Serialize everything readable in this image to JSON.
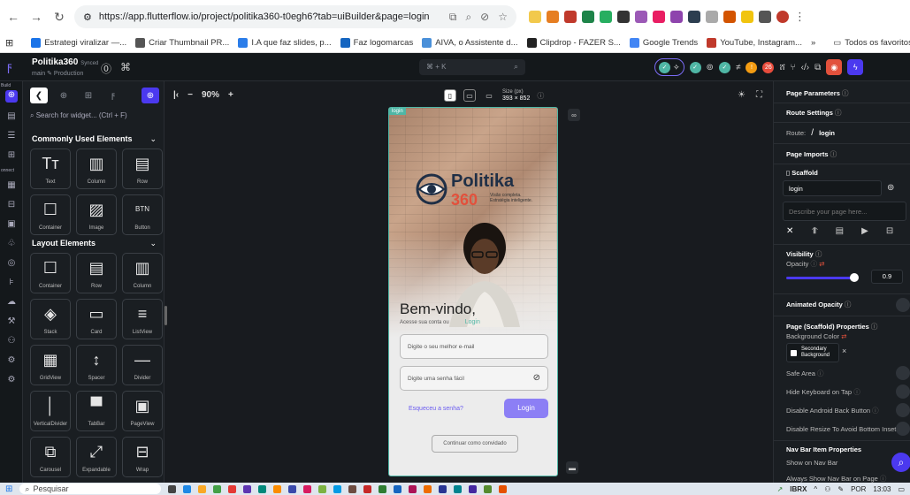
{
  "browser": {
    "url": "https://app.flutterflow.io/project/politika360-t0egh6?tab=uiBuilder&page=login",
    "bookmarks": [
      {
        "label": "Estrategi viralizar —...",
        "color": "#1a73e8"
      },
      {
        "label": "Criar Thumbnail PR...",
        "color": "#555555"
      },
      {
        "label": "I.A que faz slides, p...",
        "color": "#2b7de9"
      },
      {
        "label": "Faz logomarcas",
        "color": "#1565c0"
      },
      {
        "label": "AIVA, o Assistente d...",
        "color": "#4a90d9"
      },
      {
        "label": "Clipdrop - FAZER S...",
        "color": "#222222"
      },
      {
        "label": "Google Trends",
        "color": "#4285f4"
      },
      {
        "label": "YouTube, Instagram...",
        "color": "#c0392b"
      }
    ],
    "more": "»",
    "all_favorites": "Todos os favoritos"
  },
  "topbar": {
    "project_name": "Politika360",
    "synced": "Synced",
    "branch": "main  ✎ Production",
    "search_shortcut": "⌘ + K",
    "badge_count": "26"
  },
  "rail": {
    "build_label": "Build",
    "connect_label": "onnect"
  },
  "panel": {
    "search_placeholder": "Search for widget... (Ctrl + F)",
    "commonly_used": "Commonly Used Elements",
    "layout_elements": "Layout Elements",
    "common_items": [
      {
        "label": "Text",
        "icon": "Tт"
      },
      {
        "label": "Column",
        "icon": "▥"
      },
      {
        "label": "Row",
        "icon": "▤"
      },
      {
        "label": "Container",
        "icon": "☐"
      },
      {
        "label": "Image",
        "icon": "▨"
      },
      {
        "label": "Button",
        "icon": "BTN"
      }
    ],
    "layout_items": [
      {
        "label": "Container",
        "icon": "☐"
      },
      {
        "label": "Row",
        "icon": "▤"
      },
      {
        "label": "Column",
        "icon": "▥"
      },
      {
        "label": "Stack",
        "icon": "◈"
      },
      {
        "label": "Card",
        "icon": "▭"
      },
      {
        "label": "ListView",
        "icon": "≡"
      },
      {
        "label": "GridView",
        "icon": "▦"
      },
      {
        "label": "Spacer",
        "icon": "↕"
      },
      {
        "label": "Divider",
        "icon": "—"
      },
      {
        "label": "VerticalDivider",
        "icon": "│"
      },
      {
        "label": "TabBar",
        "icon": "▀"
      },
      {
        "label": "PageView",
        "icon": "▣"
      },
      {
        "label": "Carousel",
        "icon": "⧉"
      },
      {
        "label": "Expandable",
        "icon": "⤢"
      },
      {
        "label": "Wrap",
        "icon": "⊟"
      }
    ]
  },
  "canvas": {
    "zoom": "90%",
    "size_label": "Size (px)",
    "size_value": "393 × 852",
    "page_tag": "login"
  },
  "phone": {
    "brand": "Politika",
    "brand_num": "360",
    "tagline_1": "Visão completa.",
    "tagline_2": "Estratégia inteligente.",
    "welcome": "Bem-vindo,",
    "sub": "Acesse sua conta ou",
    "sub_link": "Login",
    "email_placeholder": "Digite o seu melhor e-mail",
    "password_placeholder": "Digite uma senha fácil",
    "forgot": "Esqueceu a senha?",
    "login_button": "Login",
    "guest_button": "Continuar como convidado"
  },
  "props": {
    "page_parameters": "Page Parameters",
    "route_settings": "Route Settings",
    "route_label": "Route:",
    "route_slash": "/",
    "route_value": "login",
    "page_imports": "Page Imports",
    "scaffold": "Scaffold",
    "scaffold_name": "login",
    "describe_placeholder": "Describe your page here...",
    "visibility": "Visibility",
    "opacity": "Opacity",
    "opacity_value": "0.9",
    "opacity_fraction": 0.9,
    "animated_opacity": "Animated Opacity",
    "scaffold_props": "Page (Scaffold) Properties",
    "bg_color": "Background Color",
    "bg_color_value_1": "Secondary",
    "bg_color_value_2": "Background",
    "safe_area": "Safe Area",
    "hide_keyboard": "Hide Keyboard on Tap",
    "disable_back": "Disable Android Back Button",
    "disable_resize": "Disable Resize To Avoid Bottom Inset",
    "nav_bar_props": "Nav Bar Item Properties",
    "show_nav": "Show on Nav Bar",
    "always_show_nav": "Always Show Nav Bar on Page"
  },
  "taskbar": {
    "search": "Pesquisar",
    "ticker": "IBRX",
    "lang": "POR",
    "time": "13:03"
  },
  "colors": {
    "accent": "#4b39ef",
    "teal": "#4fb6a5",
    "login_btn": "#8c7ff5"
  }
}
